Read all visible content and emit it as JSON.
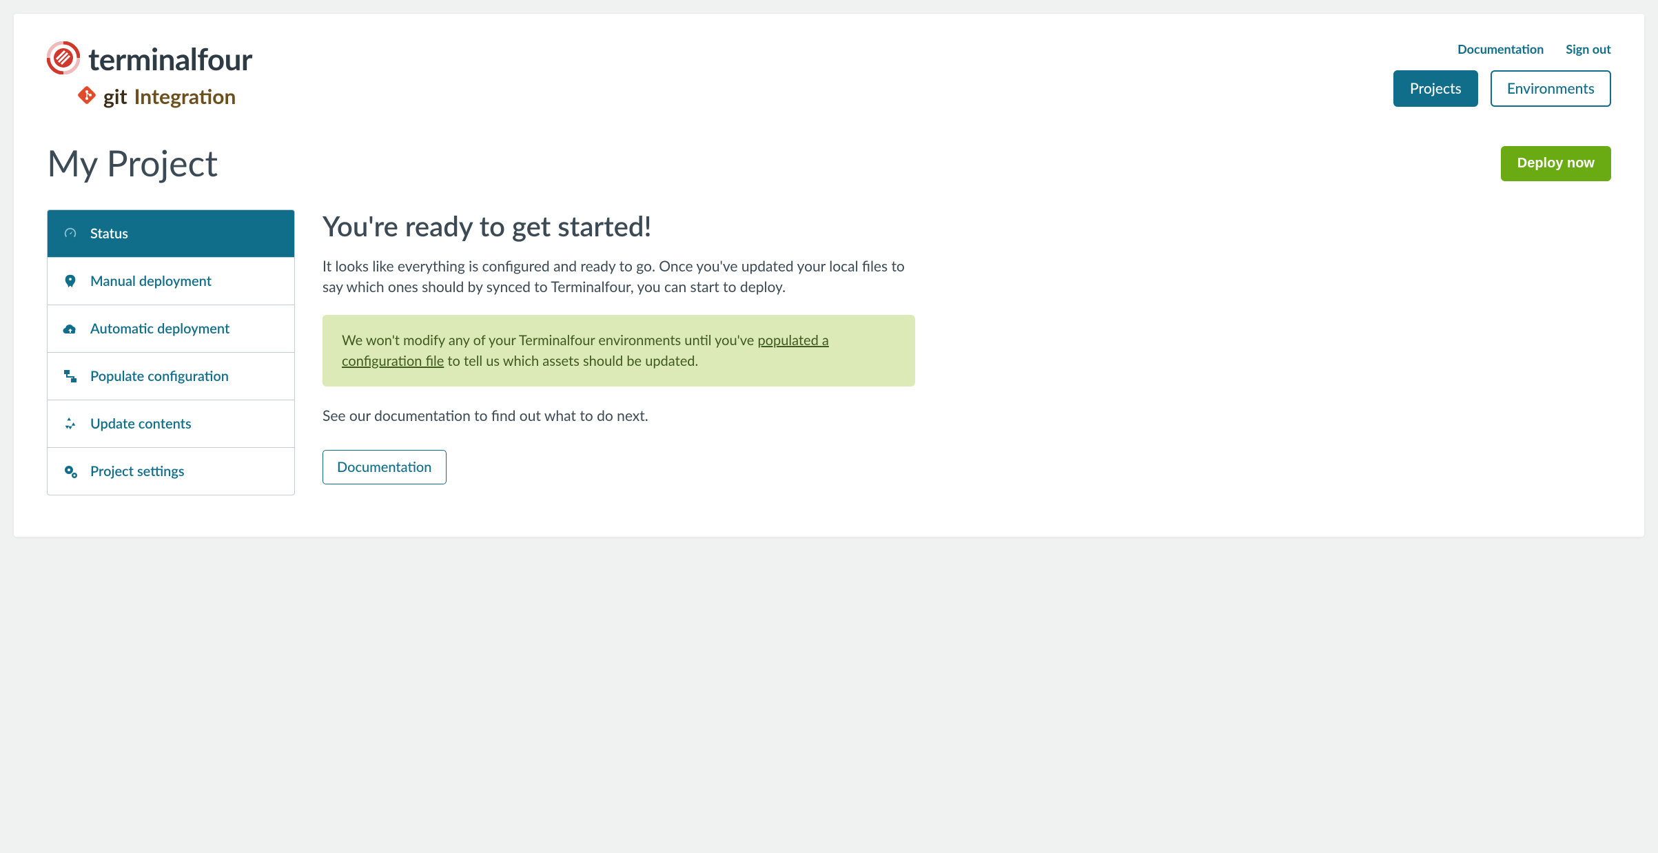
{
  "brand": {
    "name": "terminalfour",
    "sub_git": "git",
    "sub_integration": "Integration"
  },
  "header": {
    "links": {
      "documentation": "Documentation",
      "sign_out": "Sign out"
    },
    "buttons": {
      "projects": "Projects",
      "environments": "Environments"
    }
  },
  "page": {
    "title": "My Project",
    "deploy_label": "Deploy now"
  },
  "sidebar": {
    "items": [
      {
        "label": "Status"
      },
      {
        "label": "Manual deployment"
      },
      {
        "label": "Automatic deployment"
      },
      {
        "label": "Populate configuration"
      },
      {
        "label": "Update contents"
      },
      {
        "label": "Project settings"
      }
    ]
  },
  "main": {
    "heading": "You're ready to get started!",
    "intro": "It looks like everything is configured and ready to go. Once you've updated your local files to say which ones should by synced to Terminalfour, you can start to deploy.",
    "callout_pre": "We won't modify any of your Terminalfour environments until you've ",
    "callout_link": "populated a configuration file",
    "callout_post": " to tell us which assets should be updated.",
    "next_steps": "See our documentation to find out what to do next.",
    "doc_button": "Documentation"
  }
}
